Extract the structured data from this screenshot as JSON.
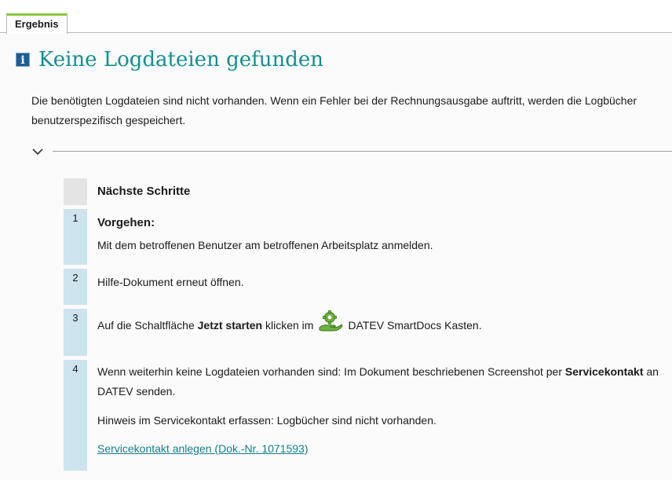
{
  "tab": {
    "label": "Ergebnis"
  },
  "page": {
    "title": "Keine Logdateien gefunden",
    "intro": "Die benötigten Logdateien sind nicht vorhanden. Wenn ein Fehler bei der Rechnungsausgabe auftritt, werden die Logbücher benutzerspezifisch gespeichert."
  },
  "icons": {
    "info": "info-icon",
    "collapse": "chevron-down-icon",
    "smartdocs": "smartdocs-hand-gear-icon"
  },
  "colors": {
    "title": "#12908f",
    "tab_accent": "#8cc63f",
    "step_marker": "#cde3ee",
    "link": "#127f8a"
  },
  "steps": {
    "heading": "Nächste Schritte",
    "items": [
      {
        "number": "1",
        "subheading": "Vorgehen:",
        "text": "Mit dem betroffenen Benutzer am betroffenen Arbeitsplatz anmelden."
      },
      {
        "number": "2",
        "text": "Hilfe-Dokument erneut öffnen."
      },
      {
        "number": "3",
        "text_before": "Auf die Schaltfläche",
        "bold": "Jetzt starten",
        "text_mid": "klicken im",
        "text_after": "DATEV SmartDocs Kasten."
      },
      {
        "number": "4",
        "text_before": "Wenn weiterhin keine Logdateien vorhanden sind: Im Dokument beschriebenen Screenshot per",
        "bold": "Servicekontakt",
        "text_after": "an DATEV senden.",
        "hint": "Hinweis im Servicekontakt erfassen: Logbücher sind nicht vorhanden.",
        "link": "Servicekontakt anlegen (Dok.-Nr. 1071593)"
      }
    ]
  }
}
